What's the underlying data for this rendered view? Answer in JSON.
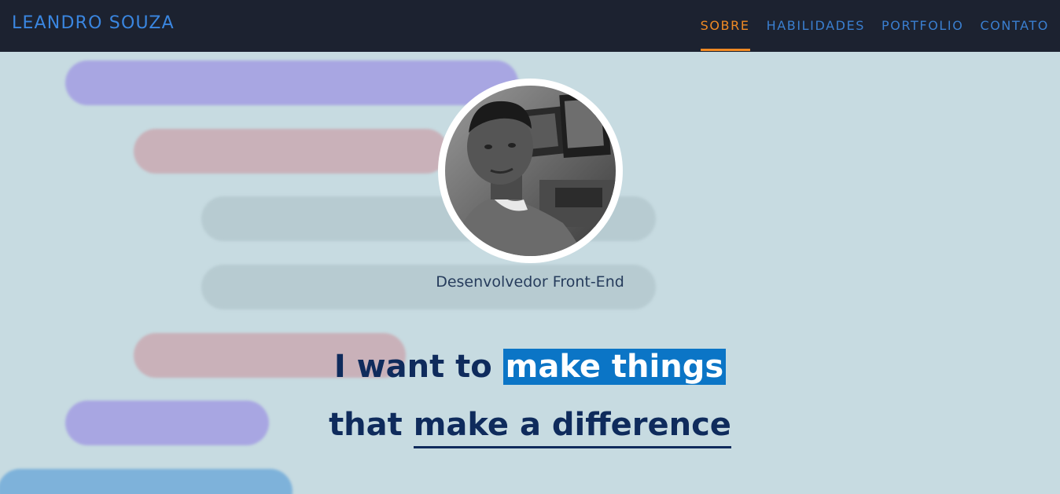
{
  "navbar": {
    "brand": "LEANDRO SOUZA",
    "items": [
      {
        "label": "SOBRE",
        "active": true
      },
      {
        "label": "HABILIDADES",
        "active": false
      },
      {
        "label": "PORTFOLIO",
        "active": false
      },
      {
        "label": "CONTATO",
        "active": false
      }
    ]
  },
  "hero": {
    "role": "Desenvolvedor Front-End",
    "headline": {
      "line1_prefix": "I want to ",
      "line1_highlight": "make things",
      "line2_prefix": "that ",
      "line2_underline": "make a difference"
    }
  },
  "colors": {
    "navbar_bg": "#1c2230",
    "accent": "#f08a24",
    "link": "#3a7fd0",
    "hero_bg": "#c7dbe1",
    "highlight": "#0b75c6",
    "headline": "#0f2b5c"
  }
}
